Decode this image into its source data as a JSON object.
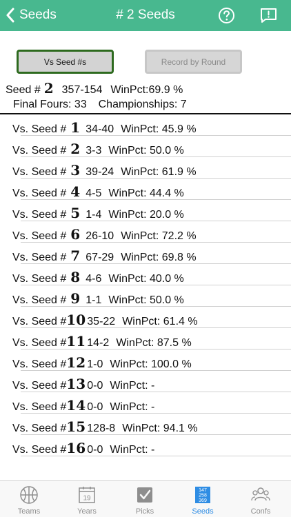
{
  "nav": {
    "back_label": "Seeds",
    "title": "# 2 Seeds",
    "bg_color": "#48b88f"
  },
  "segments": {
    "active_label": "Vs Seed #s",
    "inactive_label": "Record by Round"
  },
  "summary": {
    "seed_prefix": "Seed #",
    "seed_number": "2",
    "record": "357-154",
    "winpct": "WinPct:69.9 %",
    "final_fours": "Final Fours: 33",
    "championships": "Championships: 7"
  },
  "rows": [
    {
      "prefix": "Vs. Seed #",
      "seed": "1",
      "record": "34-40",
      "winpct": "WinPct: 45.9 %"
    },
    {
      "prefix": "Vs. Seed #",
      "seed": "2",
      "record": "3-3",
      "winpct": "WinPct: 50.0 %"
    },
    {
      "prefix": "Vs. Seed #",
      "seed": "3",
      "record": "39-24",
      "winpct": "WinPct: 61.9 %"
    },
    {
      "prefix": "Vs. Seed #",
      "seed": "4",
      "record": "4-5",
      "winpct": "WinPct: 44.4 %"
    },
    {
      "prefix": "Vs. Seed #",
      "seed": "5",
      "record": "1-4",
      "winpct": "WinPct: 20.0 %"
    },
    {
      "prefix": "Vs. Seed #",
      "seed": "6",
      "record": "26-10",
      "winpct": "WinPct: 72.2 %"
    },
    {
      "prefix": "Vs. Seed #",
      "seed": "7",
      "record": "67-29",
      "winpct": "WinPct: 69.8 %"
    },
    {
      "prefix": "Vs. Seed #",
      "seed": "8",
      "record": "4-6",
      "winpct": "WinPct: 40.0 %"
    },
    {
      "prefix": "Vs. Seed #",
      "seed": "9",
      "record": "1-1",
      "winpct": "WinPct: 50.0 %"
    },
    {
      "prefix": "Vs. Seed #",
      "seed": "10",
      "record": "35-22",
      "winpct": "WinPct: 61.4 %"
    },
    {
      "prefix": "Vs. Seed #",
      "seed": "11",
      "record": "14-2",
      "winpct": "WinPct: 87.5 %"
    },
    {
      "prefix": "Vs. Seed #",
      "seed": "12",
      "record": "1-0",
      "winpct": "WinPct: 100.0 %"
    },
    {
      "prefix": "Vs. Seed #",
      "seed": "13",
      "record": "0-0",
      "winpct": "WinPct: -"
    },
    {
      "prefix": "Vs. Seed #",
      "seed": "14",
      "record": "0-0",
      "winpct": "WinPct: -"
    },
    {
      "prefix": "Vs. Seed #",
      "seed": "15",
      "record": "128-8",
      "winpct": "WinPct: 94.1 %"
    },
    {
      "prefix": "Vs. Seed #",
      "seed": "16",
      "record": "0-0",
      "winpct": "WinPct: -"
    }
  ],
  "tabs": [
    {
      "label": "Teams",
      "icon": "basketball-icon",
      "active": false
    },
    {
      "label": "Years",
      "icon": "calendar-icon",
      "calendar_day": "19",
      "active": false
    },
    {
      "label": "Picks",
      "icon": "checkmark-square-icon",
      "active": false
    },
    {
      "label": "Seeds",
      "icon": "number-grid-icon",
      "grid_digits": [
        "147",
        "258",
        "369"
      ],
      "active": true
    },
    {
      "label": "Confs",
      "icon": "group-icon",
      "active": false
    }
  ],
  "colors": {
    "accent": "#48b88f",
    "tab_active": "#2f8de4",
    "tab_inactive": "#8e8e8e",
    "segment_active_border": "#2d6a1e"
  }
}
